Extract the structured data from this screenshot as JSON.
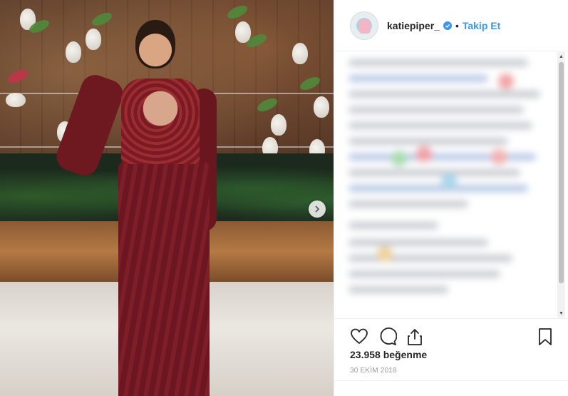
{
  "post": {
    "photo_alt": "",
    "carousel_next": "chevron-right-icon"
  },
  "header": {
    "username": "katiepiper_",
    "separator": "•",
    "follow_label": "Takip Et",
    "verified_icon": "verified-badge-icon",
    "accent_color": "#3897f0"
  },
  "actions": {
    "like_icon": "heart-icon",
    "comment_icon": "comment-icon",
    "share_icon": "share-icon",
    "save_icon": "bookmark-icon"
  },
  "likes_text": "23.958 beğenme",
  "date_text": "30 EKİM 2018"
}
